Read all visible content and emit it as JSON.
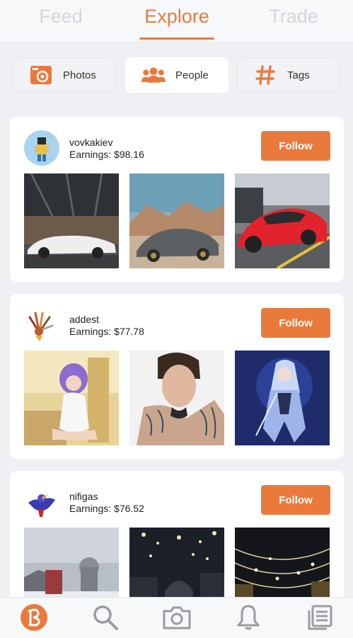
{
  "colors": {
    "accent": "#ea7a3c",
    "inactive_tab": "#d4d6db",
    "background": "#eef0f4"
  },
  "top_tabs": [
    {
      "label": "Feed",
      "active": false
    },
    {
      "label": "Explore",
      "active": true
    },
    {
      "label": "Trade",
      "active": false
    }
  ],
  "filters": [
    {
      "label": "Photos",
      "icon": "photo-icon",
      "active": false
    },
    {
      "label": "People",
      "icon": "people-icon",
      "active": true
    },
    {
      "label": "Tags",
      "icon": "hashtag-icon",
      "active": false
    }
  ],
  "users": [
    {
      "username": "vovkakiev",
      "earnings": "Earnings: $98.16",
      "follow_label": "Follow",
      "photos": [
        "white-supercar-in-garage",
        "grey-lamborghini-in-desert",
        "red-porsche-parked"
      ]
    },
    {
      "username": "addest",
      "earnings": "Earnings: $77.78",
      "follow_label": "Follow",
      "photos": [
        "cosplay-purple-hair",
        "tattooed-man-portrait",
        "anime-armored-girl"
      ]
    },
    {
      "username": "nifigas",
      "earnings": "Earnings: $76.52",
      "follow_label": "Follow",
      "photos": [
        "snowy-city-cathedral",
        "night-street-lights",
        "night-cathedral-lights"
      ]
    }
  ],
  "bottom_nav": [
    {
      "name": "home",
      "icon": "steepshot-logo-icon",
      "active": true
    },
    {
      "name": "search",
      "icon": "search-icon",
      "active": false
    },
    {
      "name": "camera",
      "icon": "camera-icon",
      "active": false
    },
    {
      "name": "notifications",
      "icon": "bell-icon",
      "active": false
    },
    {
      "name": "profile",
      "icon": "profile-list-icon",
      "active": false
    }
  ]
}
